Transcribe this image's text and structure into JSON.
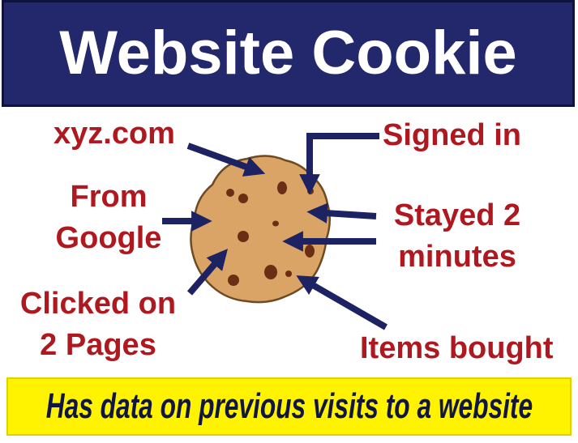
{
  "title": "Website Cookie",
  "footer": "Has data on previous visits to a website",
  "labels": {
    "xyz": "xyz.com",
    "signed_in": "Signed in",
    "from_google_line1": "From",
    "from_google_line2": "Google",
    "stayed_line1": "Stayed 2",
    "stayed_line2": "minutes",
    "clicked_line1": "Clicked on",
    "clicked_line2": "2 Pages",
    "items_bought": "Items bought"
  },
  "colors": {
    "title_bg": "#22286b",
    "title_text": "#ffffff",
    "label_text": "#b01820",
    "arrow": "#1d2262",
    "footer_bg": "#fff300",
    "footer_text": "#10163f",
    "cookie": "#d9a465",
    "chip": "#6b2e14"
  },
  "icons": {
    "cookie": "cookie-icon",
    "arrow": "arrow-icon"
  }
}
